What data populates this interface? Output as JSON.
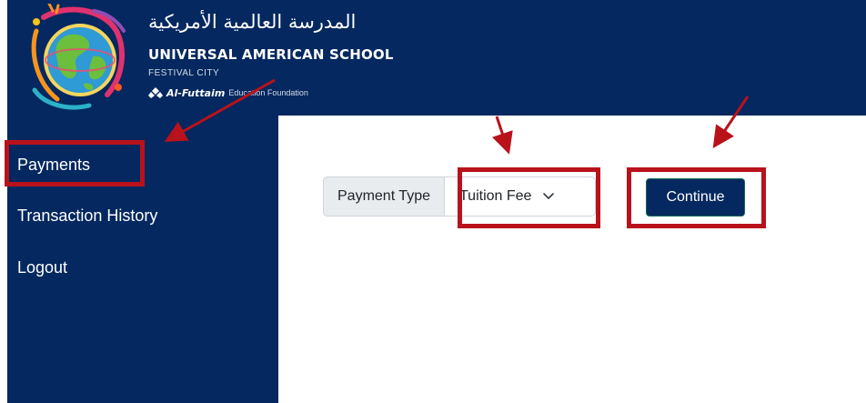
{
  "header": {
    "school_name_arabic": "المدرسة العالمية الأمريكية",
    "school_name": "UNIVERSAL AMERICAN SCHOOL",
    "campus": "FESTIVAL CITY",
    "foundation_brand": "Al-Futtaim",
    "foundation_text": "Education Foundation"
  },
  "sidebar": {
    "items": [
      {
        "label": "Payments"
      },
      {
        "label": "Transaction History"
      },
      {
        "label": "Logout"
      }
    ]
  },
  "payment_form": {
    "type_label": "Payment Type",
    "selected_option": "Tuition Fee",
    "continue_label": "Continue"
  },
  "colors": {
    "brand_navy": "#04285f",
    "annotation_red": "#b9121b",
    "button_border": "#0e6b59"
  },
  "icons": {
    "logo": "school-globe-logo",
    "foundation": "al-futtaim-emblem-icon",
    "dropdown": "chevron-down-icon",
    "annotation": "arrow-annotation"
  }
}
